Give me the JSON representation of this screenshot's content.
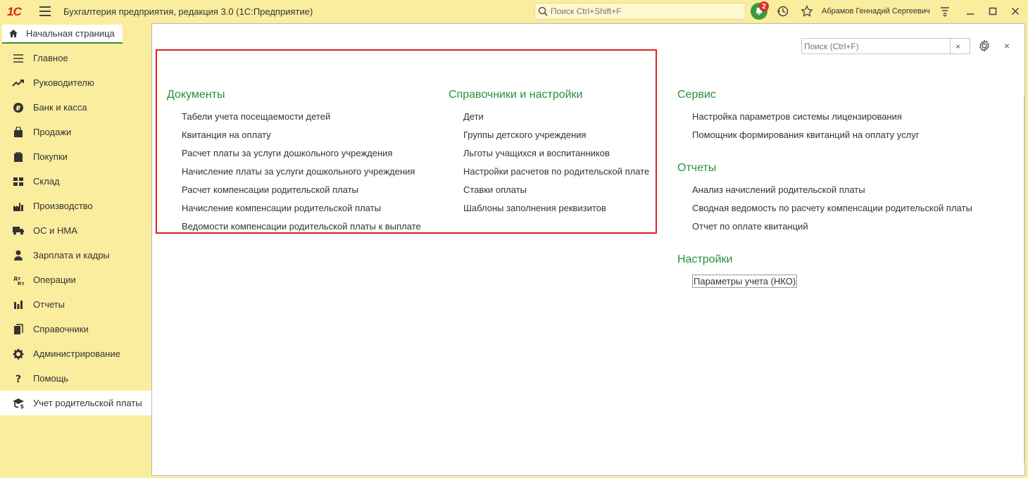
{
  "titlebar": {
    "logo": "1С",
    "app_title": "Бухгалтерия предприятия, редакция 3.0  (1С:Предприятие)",
    "search_placeholder": "Поиск Ctrl+Shift+F",
    "notifications_count": "2",
    "user_name": "Абрамов Геннадий Сергеевич"
  },
  "home_tab": {
    "label": "Начальная страница"
  },
  "sidebar": {
    "items": [
      {
        "label": "Главное",
        "icon": "menu-lines-icon"
      },
      {
        "label": "Руководителю",
        "icon": "trend-up-icon"
      },
      {
        "label": "Банк и касса",
        "icon": "ruble-coin-icon"
      },
      {
        "label": "Продажи",
        "icon": "shopping-bag-icon"
      },
      {
        "label": "Покупки",
        "icon": "cart-icon"
      },
      {
        "label": "Склад",
        "icon": "warehouse-grid-icon"
      },
      {
        "label": "Производство",
        "icon": "factory-icon"
      },
      {
        "label": "ОС и НМА",
        "icon": "truck-icon"
      },
      {
        "label": "Зарплата и кадры",
        "icon": "person-icon"
      },
      {
        "label": "Операции",
        "icon": "dt-kt-icon"
      },
      {
        "label": "Отчеты",
        "icon": "bar-chart-icon"
      },
      {
        "label": "Справочники",
        "icon": "books-icon"
      },
      {
        "label": "Администрирование",
        "icon": "gear-icon"
      },
      {
        "label": "Помощь",
        "icon": "question-icon"
      },
      {
        "label": "Учет родительской платы",
        "icon": "graduation-cap-icon"
      }
    ]
  },
  "panel": {
    "search_placeholder": "Поиск (Ctrl+F)",
    "clear_label": "×",
    "close_label": "×"
  },
  "sections": {
    "documents": {
      "title": "Документы",
      "items": [
        "Табели учета посещаемости детей",
        "Квитанция на оплату",
        "Расчет платы за услуги дошкольного учреждения",
        "Начисление платы за услуги дошкольного учреждения",
        "Расчет компенсации родительской платы",
        "Начисление компенсации родительской платы",
        "Ведомости компенсации родительской платы к выплате"
      ]
    },
    "catalogs": {
      "title": "Справочники и настройки",
      "items": [
        "Дети",
        "Группы детского учреждения",
        "Льготы учащихся и воспитанников",
        "Настройки расчетов по родительской плате",
        "Ставки оплаты",
        "Шаблоны заполнения реквизитов"
      ]
    },
    "service": {
      "title": "Сервис",
      "items": [
        "Настройка параметров системы лицензирования",
        "Помощник формирования квитанций на оплату услуг"
      ]
    },
    "reports": {
      "title": "Отчеты",
      "items": [
        "Анализ начислений родительской платы",
        "Сводная ведомость по расчету компенсации родительской платы",
        "Отчет по оплате квитанций"
      ]
    },
    "settings": {
      "title": "Настройки",
      "items": [
        "Параметры учета (НКО)"
      ]
    }
  },
  "colors": {
    "accent_green": "#27913a",
    "background_yellow": "#fbed9e",
    "highlight_red": "#e0201c"
  }
}
